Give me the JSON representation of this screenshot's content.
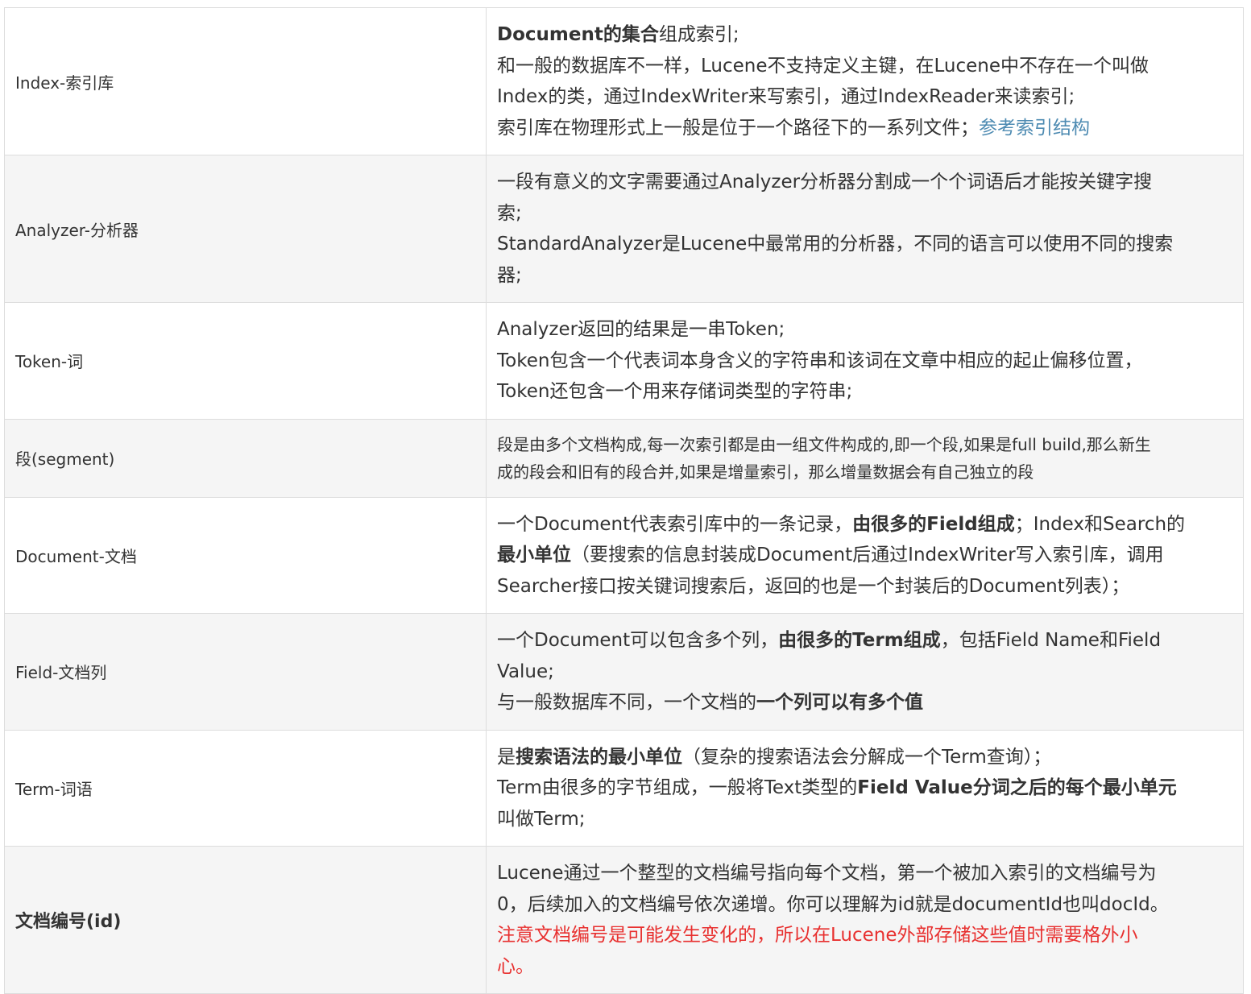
{
  "rows": [
    {
      "term": "Index-索引库",
      "lines": [
        [
          {
            "t": "Document的集合",
            "b": true
          },
          {
            "t": "组成索引;"
          }
        ],
        [
          {
            "t": "和一般的数据库不一样，Lucene不支持定义主键，在Lucene中不存在一个叫做"
          }
        ],
        [
          {
            "t": "Index的类，通过IndexWriter来写索引，通过IndexReader来读索引;"
          }
        ],
        [
          {
            "t": "索引库在物理形式上一般是位于一个路径下的一系列文件；"
          },
          {
            "t": "参考索引结构",
            "link": true
          }
        ]
      ]
    },
    {
      "term": "Analyzer-分析器",
      "lines": [
        [
          {
            "t": "一段有意义的文字需要通过Analyzer分析器分割成一个个词语后才能按关键字搜"
          }
        ],
        [
          {
            "t": "索;"
          }
        ],
        [
          {
            "t": "StandardAnalyzer是Lucene中最常用的分析器，不同的语言可以使用不同的搜索"
          }
        ],
        [
          {
            "t": "器;"
          }
        ]
      ]
    },
    {
      "term": "Token-词",
      "lines": [
        [
          {
            "t": "Analyzer返回的结果是一串Token;"
          }
        ],
        [
          {
            "t": "Token包含一个代表词本身含义的字符串和该词在文章中相应的起止偏移位置，"
          }
        ],
        [
          {
            "t": "Token还包含一个用来存储词类型的字符串;"
          }
        ]
      ]
    },
    {
      "term": "段(segment)",
      "small": true,
      "lines": [
        [
          {
            "t": "段是由多个文档构成,每一次索引都是由一组文件构成的,即一个段,如果是full build,那么新生"
          }
        ],
        [
          {
            "t": "成的段会和旧有的段合并,如果是增量索引，那么增量数据会有自己独立的段"
          }
        ]
      ]
    },
    {
      "term": "Document-文档",
      "lines": [
        [
          {
            "t": "一个Document代表索引库中的一条记录，"
          },
          {
            "t": "由很多的Field组成",
            "b": true
          },
          {
            "t": "；Index和Search的"
          }
        ],
        [
          {
            "t": "最小单位",
            "b": true
          },
          {
            "t": "（要搜索的信息封装成Document后通过IndexWriter写入索引库，调用"
          }
        ],
        [
          {
            "t": "Searcher接口按关键词搜索后，返回的也是一个封装后的Document列表）；"
          }
        ]
      ]
    },
    {
      "term": "Field-文档列",
      "lines": [
        [
          {
            "t": "一个Document可以包含多个列，"
          },
          {
            "t": "由很多的Term组成",
            "b": true
          },
          {
            "t": "，包括Field Name和Field"
          }
        ],
        [
          {
            "t": "Value;"
          }
        ],
        [
          {
            "t": "与一般数据库不同，一个文档的"
          },
          {
            "t": "一个列可以有多个值",
            "b": true
          }
        ]
      ]
    },
    {
      "term": "Term-词语",
      "lines": [
        [
          {
            "t": "是"
          },
          {
            "t": "搜索语法的最小单位",
            "b": true
          },
          {
            "t": "（复杂的搜索语法会分解成一个Term查询）；"
          }
        ],
        [
          {
            "t": "Term由很多的字节组成，一般将Text类型的"
          },
          {
            "t": "Field Value分词之后的每个最小单元",
            "b": true
          }
        ],
        [
          {
            "t": "叫做Term;"
          }
        ]
      ]
    },
    {
      "term": "文档编号(id)",
      "bold_term": true,
      "lines": [
        [
          {
            "t": "Lucene通过一个整型的文档编号指向每个文档，第一个被加入索引的文档编号为"
          }
        ],
        [
          {
            "t": "0，后续加入的文档编号依次递增。你可以理解为id就是documentId也叫docId。"
          }
        ],
        [
          {
            "t": "注意文档编号是可能发生变化的，所以在Lucene外部存储这些值时需要格外小",
            "warn": true
          }
        ],
        [
          {
            "t": "心。",
            "warn": true
          }
        ]
      ]
    }
  ],
  "colors": {
    "link": "#4e8bb2",
    "warning": "#e8302f",
    "border": "#dddddd",
    "stripe": "#f5f5f5",
    "text": "#333333"
  }
}
